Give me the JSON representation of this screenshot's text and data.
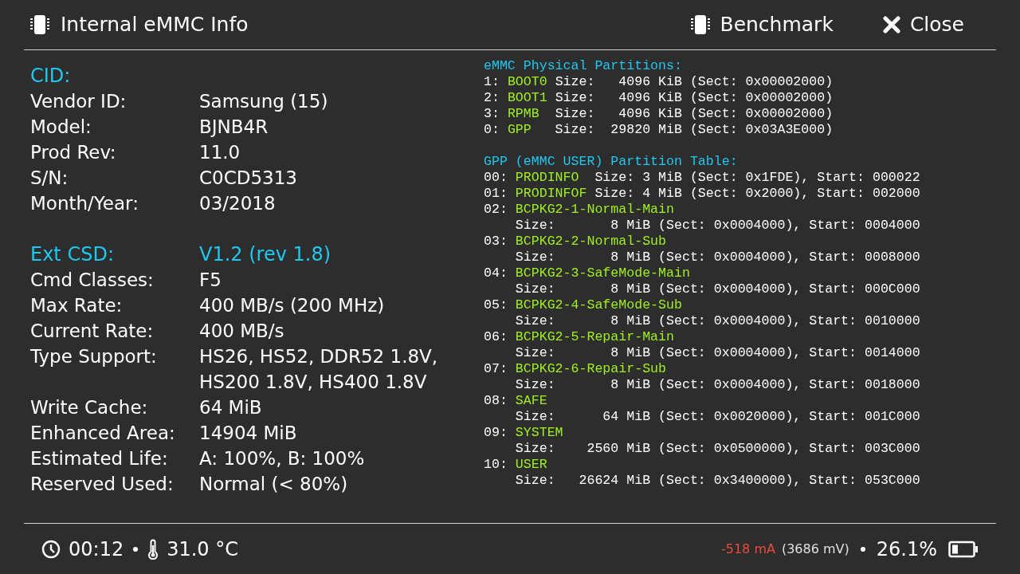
{
  "header": {
    "title": "Internal eMMC Info",
    "buttons": [
      {
        "label": "Benchmark",
        "kind": "benchmark"
      },
      {
        "label": "Close",
        "kind": "close"
      }
    ]
  },
  "cid": {
    "title": "CID:",
    "rows": [
      {
        "label": "Vendor ID:",
        "value": "Samsung (15)"
      },
      {
        "label": "Model:",
        "value": "BJNB4R"
      },
      {
        "label": "Prod Rev:",
        "value": "11.0"
      },
      {
        "label": "S/N:",
        "value": "C0CD5313"
      },
      {
        "label": "Month/Year:",
        "value": "03/2018"
      }
    ]
  },
  "ext_csd": {
    "title": "Ext CSD:",
    "version": "V1.2 (rev 1.8)",
    "rows": [
      {
        "label": "Cmd Classes:",
        "value": "F5"
      },
      {
        "label": "Max Rate:",
        "value": "400 MB/s (200 MHz)"
      },
      {
        "label": "Current Rate:",
        "value": "400 MB/s"
      },
      {
        "label": "Type Support:",
        "value": "HS26, HS52, DDR52 1.8V, HS200 1.8V, HS400 1.8V"
      },
      {
        "label": "Write Cache:",
        "value": "64 MiB"
      },
      {
        "label": "Enhanced Area:",
        "value": "14904 MiB"
      },
      {
        "label": "Estimated Life:",
        "value": "A: 100%, B: 100%"
      },
      {
        "label": "Reserved Used:",
        "value": "Normal (< 80%)"
      }
    ]
  },
  "physical_partitions": {
    "title": "eMMC Physical Partitions:",
    "entries": [
      {
        "index": "1:",
        "name": "BOOT0",
        "info": " Size:   4096 KiB (Sect: 0x00002000)"
      },
      {
        "index": "2:",
        "name": "BOOT1",
        "info": " Size:   4096 KiB (Sect: 0x00002000)"
      },
      {
        "index": "3:",
        "name": "RPMB",
        "info": "  Size:   4096 KiB (Sect: 0x00002000)"
      },
      {
        "index": "0:",
        "name": "GPP",
        "info": "   Size:  29820 MiB (Sect: 0x03A3E000)"
      }
    ]
  },
  "gpp_table": {
    "title": "GPP (eMMC USER) Partition Table:",
    "entries": [
      {
        "kind": "single",
        "index": "00:",
        "name": "PRODINFO",
        "info": "  Size: 3 MiB (Sect: 0x1FDE), Start: 000022"
      },
      {
        "kind": "single",
        "index": "01:",
        "name": "PRODINFOF",
        "info": " Size: 4 MiB (Sect: 0x2000), Start: 002000"
      },
      {
        "kind": "two_line",
        "index": "02:",
        "name": "BCPKG2-1-Normal-Main",
        "info": "Size:       8 MiB (Sect: 0x0004000), Start: 0004000"
      },
      {
        "kind": "two_line",
        "index": "03:",
        "name": "BCPKG2-2-Normal-Sub",
        "info": "Size:       8 MiB (Sect: 0x0004000), Start: 0008000"
      },
      {
        "kind": "two_line",
        "index": "04:",
        "name": "BCPKG2-3-SafeMode-Main",
        "info": "Size:       8 MiB (Sect: 0x0004000), Start: 000C000"
      },
      {
        "kind": "two_line",
        "index": "05:",
        "name": "BCPKG2-4-SafeMode-Sub",
        "info": "Size:       8 MiB (Sect: 0x0004000), Start: 0010000"
      },
      {
        "kind": "two_line",
        "index": "06:",
        "name": "BCPKG2-5-Repair-Main",
        "info": "Size:       8 MiB (Sect: 0x0004000), Start: 0014000"
      },
      {
        "kind": "two_line",
        "index": "07:",
        "name": "BCPKG2-6-Repair-Sub",
        "info": "Size:       8 MiB (Sect: 0x0004000), Start: 0018000"
      },
      {
        "kind": "two_line",
        "index": "08:",
        "name": "SAFE",
        "info": "Size:      64 MiB (Sect: 0x0020000), Start: 001C000"
      },
      {
        "kind": "two_line",
        "index": "09:",
        "name": "SYSTEM",
        "info": "Size:    2560 MiB (Sect: 0x0500000), Start: 003C000"
      },
      {
        "kind": "two_line",
        "index": "10:",
        "name": "USER",
        "info": "Size:   26624 MiB (Sect: 0x3400000), Start: 053C000"
      }
    ]
  },
  "status_bar": {
    "time": "00:12",
    "temperature": "31.0 °C",
    "current": "-518 mA",
    "voltage": "(3686 mV)",
    "battery": "26.1%"
  }
}
